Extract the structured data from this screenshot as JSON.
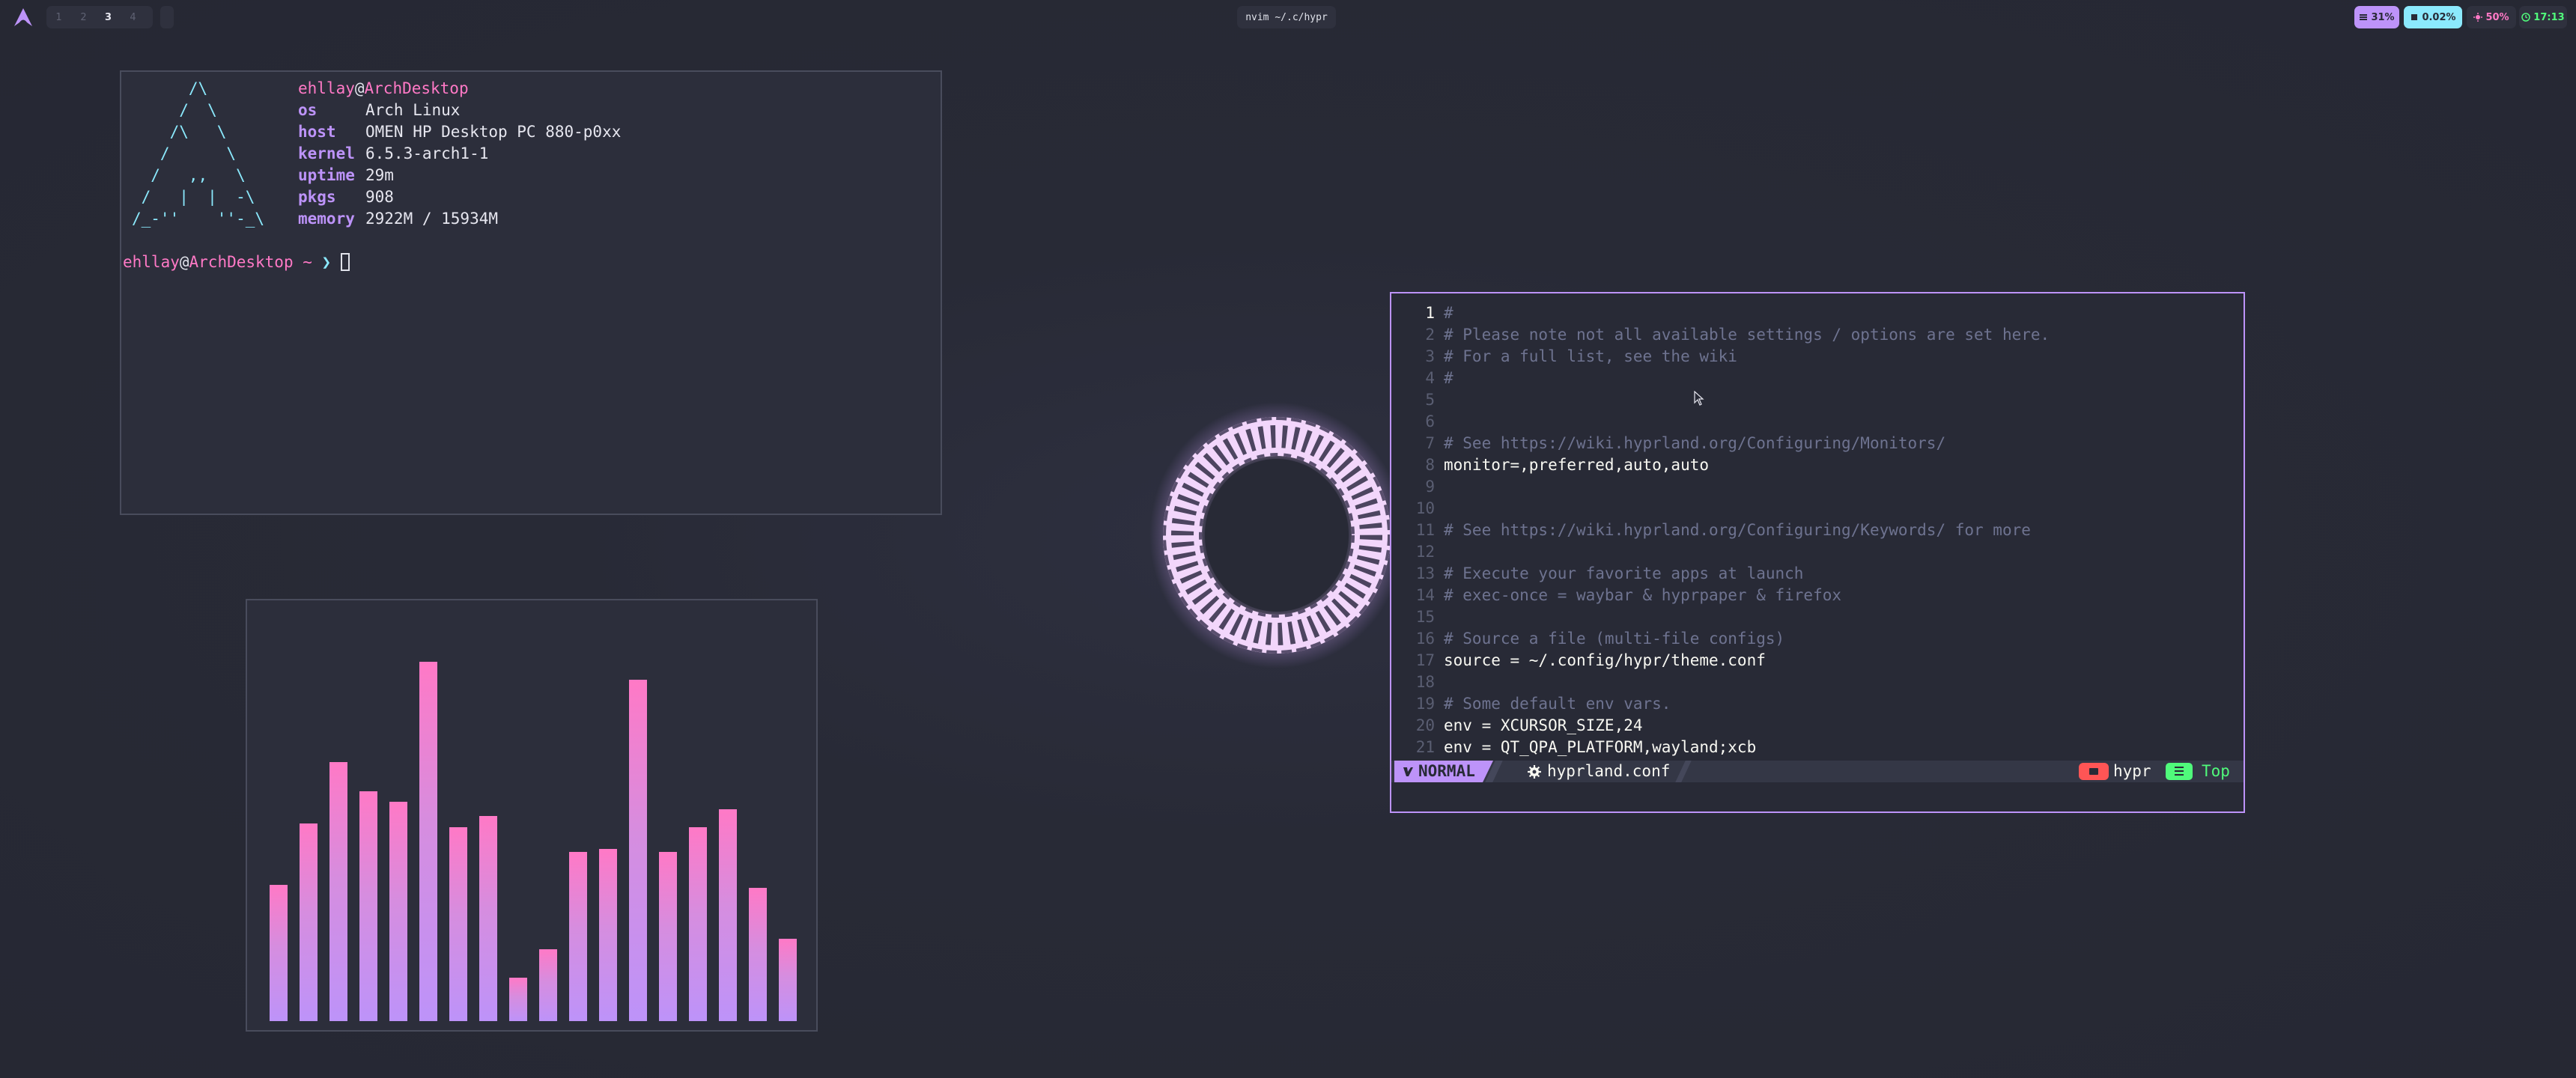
{
  "topbar": {
    "workspaces": [
      "1",
      "2",
      "3",
      "4"
    ],
    "active_workspace": "3",
    "window_title": "nvim ~/.c/hypr",
    "memory": "31%",
    "cpu": "0.02%",
    "brightness": "50%",
    "clock": "17:13",
    "icons": {
      "launcher": "arch-logo-icon",
      "memory": "memory-icon",
      "cpu": "cpu-icon",
      "brightness": "brightness-icon",
      "clock": "clock-icon"
    }
  },
  "fetch": {
    "user": "ehllay",
    "at": "@",
    "host": "ArchDesktop",
    "ascii": [
      "      /\\      ",
      "     /  \\     ",
      "    /\\   \\    ",
      "   /      \\   ",
      "  /   ,,   \\  ",
      " /   |  |  -\\ ",
      "/_-''    ''-_\\"
    ],
    "rows": [
      {
        "key": "os",
        "value": "Arch Linux"
      },
      {
        "key": "host",
        "value": "OMEN HP Desktop PC 880-p0xx"
      },
      {
        "key": "kernel",
        "value": "6.5.3-arch1-1"
      },
      {
        "key": "uptime",
        "value": "29m"
      },
      {
        "key": "pkgs",
        "value": "908"
      },
      {
        "key": "memory",
        "value": "2922M / 15934M"
      }
    ],
    "prompt_dir": " ~ ",
    "prompt_arrow": "❯"
  },
  "visualizer": {
    "levels": [
      0.38,
      0.55,
      0.72,
      0.64,
      0.61,
      1.0,
      0.54,
      0.57,
      0.12,
      0.2,
      0.47,
      0.48,
      0.95,
      0.47,
      0.54,
      0.59,
      0.37,
      0.23
    ]
  },
  "editor": {
    "lines": [
      {
        "n": "1",
        "text": "#",
        "comment": true
      },
      {
        "n": "2",
        "text": "# Please note not all available settings / options are set here.",
        "comment": true
      },
      {
        "n": "3",
        "text": "# For a full list, see the wiki",
        "comment": true
      },
      {
        "n": "4",
        "text": "#",
        "comment": true
      },
      {
        "n": "5",
        "text": "",
        "comment": false
      },
      {
        "n": "6",
        "text": "",
        "comment": false
      },
      {
        "n": "7",
        "text": "# See https://wiki.hyprland.org/Configuring/Monitors/",
        "comment": true
      },
      {
        "n": "8",
        "text": "monitor=,preferred,auto,auto",
        "comment": false
      },
      {
        "n": "9",
        "text": "",
        "comment": false
      },
      {
        "n": "10",
        "text": "",
        "comment": false
      },
      {
        "n": "11",
        "text": "# See https://wiki.hyprland.org/Configuring/Keywords/ for more",
        "comment": true
      },
      {
        "n": "12",
        "text": "",
        "comment": false
      },
      {
        "n": "13",
        "text": "# Execute your favorite apps at launch",
        "comment": true
      },
      {
        "n": "14",
        "text": "# exec-once = waybar & hyprpaper & firefox",
        "comment": true
      },
      {
        "n": "15",
        "text": "",
        "comment": false
      },
      {
        "n": "16",
        "text": "# Source a file (multi-file configs)",
        "comment": true
      },
      {
        "n": "17",
        "text": "source = ~/.config/hypr/theme.conf",
        "comment": false
      },
      {
        "n": "18",
        "text": "",
        "comment": false
      },
      {
        "n": "19",
        "text": "# Some default env vars.",
        "comment": true
      },
      {
        "n": "20",
        "text": "env = XCURSOR_SIZE,24",
        "comment": false
      },
      {
        "n": "21",
        "text": "env = QT_QPA_PLATFORM,wayland;xcb",
        "comment": false
      }
    ],
    "current_line": "1",
    "statusline": {
      "mode": "NORMAL",
      "file": "hyprland.conf",
      "dir": "hypr",
      "position": "Top"
    }
  },
  "colors": {
    "background": "#282a36",
    "purple": "#bd93f9",
    "pink": "#ff79c6",
    "cyan": "#8be9fd",
    "green": "#50fa7b",
    "red": "#ff5555"
  }
}
